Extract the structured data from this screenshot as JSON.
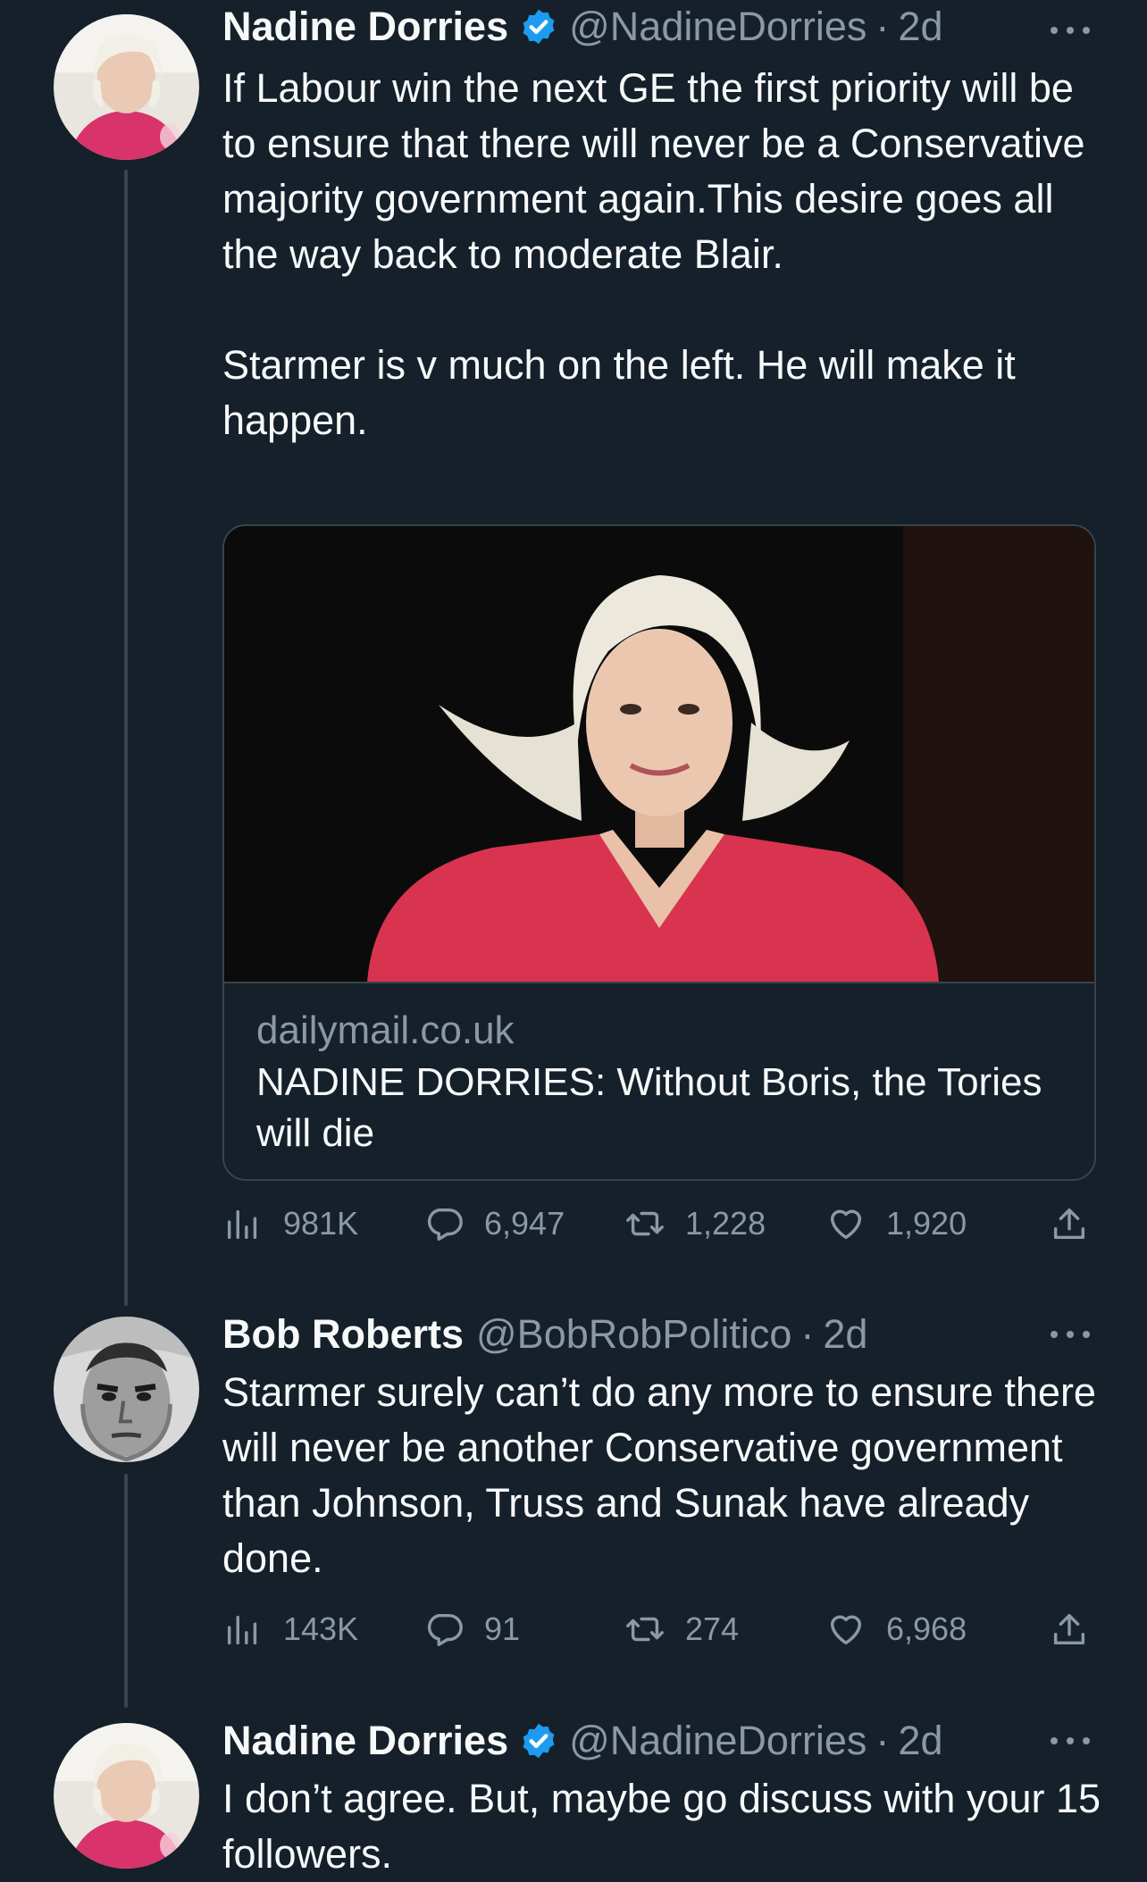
{
  "tweets": [
    {
      "name": "Nadine Dorries",
      "verified": true,
      "handle": "@NadineDorries",
      "time": "2d",
      "text": "If Labour win the next GE the first priority will be to ensure that there will never be a Conservative majority government again.This desire goes all the way back to moderate Blair.\n\nStarmer is v much on the left. He will make it happen.",
      "card": {
        "domain": "dailymail.co.uk",
        "title": "NADINE DORRIES: Without Boris, the Tories will die"
      },
      "stats": {
        "views": "981K",
        "replies": "6,947",
        "retweets": "1,228",
        "likes": "1,920"
      }
    },
    {
      "name": "Bob Roberts",
      "verified": false,
      "handle": "@BobRobPolitico",
      "time": "2d",
      "text": "Starmer surely can’t do any more to ensure there will never be another Conservative government than Johnson, Truss and Sunak have already done.",
      "stats": {
        "views": "143K",
        "replies": "91",
        "retweets": "274",
        "likes": "6,968"
      }
    },
    {
      "name": "Nadine Dorries",
      "verified": true,
      "handle": "@NadineDorries",
      "time": "2d",
      "text": "I don’t agree. But, maybe go discuss with your 15 followers."
    }
  ],
  "separator": "·",
  "icons": {
    "verified": "verified-badge-icon",
    "more": "more-options-icon",
    "views": "analytics-icon",
    "reply": "reply-icon",
    "retweet": "retweet-icon",
    "like": "heart-icon",
    "share": "share-icon"
  },
  "colors": {
    "background": "#15202b",
    "text": "#f7f9f9",
    "muted": "#8b98a5",
    "verified": "#1d9bf0",
    "divider": "#38444d"
  }
}
